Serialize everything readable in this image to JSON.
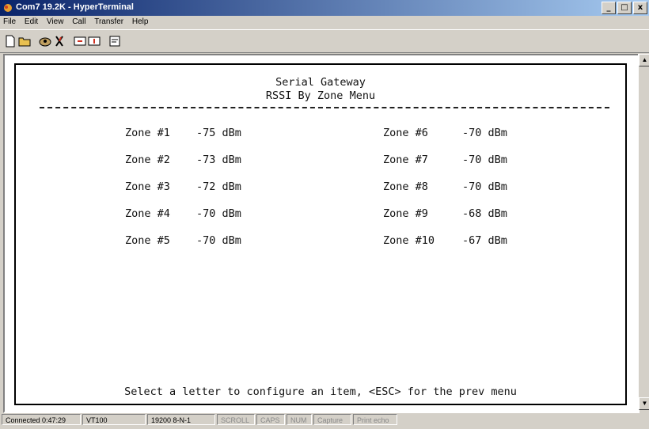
{
  "window": {
    "title": "Com7 19.2K - HyperTerminal"
  },
  "window_controls": {
    "minimize": "_",
    "maximize": "□",
    "close": "x"
  },
  "menu": [
    "File",
    "Edit",
    "View",
    "Call",
    "Transfer",
    "Help"
  ],
  "toolbar": [
    "new-icon",
    "open-icon",
    "connect-icon",
    "disconnect-icon",
    "send-icon",
    "receive-icon",
    "properties-icon"
  ],
  "terminal": {
    "header_line1": "Serial Gateway",
    "header_line2": "RSSI By Zone Menu",
    "zones_left": [
      {
        "label": "Zone #1",
        "value": "-75 dBm"
      },
      {
        "label": "Zone #2",
        "value": "-73 dBm"
      },
      {
        "label": "Zone #3",
        "value": "-72 dBm"
      },
      {
        "label": "Zone #4",
        "value": "-70 dBm"
      },
      {
        "label": "Zone #5",
        "value": "-70 dBm"
      }
    ],
    "zones_right": [
      {
        "label": "Zone #6",
        "value": "-70 dBm"
      },
      {
        "label": "Zone #7",
        "value": "-70 dBm"
      },
      {
        "label": "Zone #8",
        "value": "-70 dBm"
      },
      {
        "label": "Zone #9",
        "value": "-68 dBm"
      },
      {
        "label": "Zone #10",
        "value": "-67 dBm"
      }
    ],
    "prompt": "Select a letter to configure an item, <ESC> for the prev menu"
  },
  "statusbar": {
    "connected": "Connected 0:47:29",
    "emulation": "VT100",
    "settings": "19200 8-N-1",
    "scroll": "SCROLL",
    "caps": "CAPS",
    "num": "NUM",
    "capture": "Capture",
    "print_echo": "Print echo"
  }
}
